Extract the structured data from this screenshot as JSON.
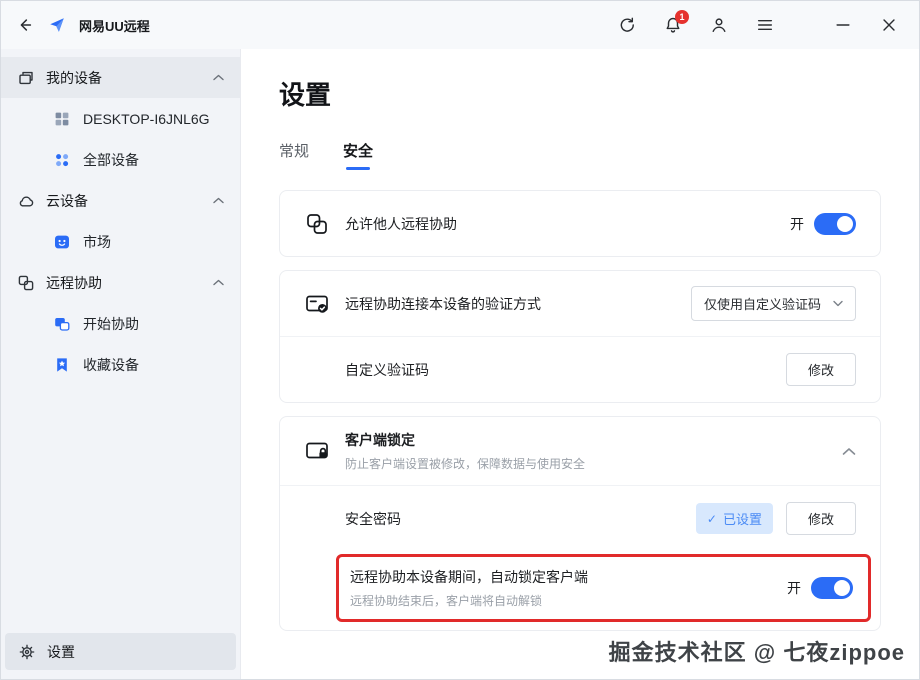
{
  "titlebar": {
    "app_title": "网易UU远程",
    "notification_badge": "1"
  },
  "sidebar": {
    "groups": [
      {
        "header": "我的设备",
        "items": [
          "DESKTOP-I6JNL6G",
          "全部设备"
        ]
      },
      {
        "header": "云设备",
        "items": [
          "市场"
        ]
      },
      {
        "header": "远程协助",
        "items": [
          "开始协助",
          "收藏设备"
        ]
      }
    ],
    "footer_label": "设置"
  },
  "main": {
    "page_title": "设置",
    "tabs": {
      "general": "常规",
      "security": "安全"
    },
    "rows": {
      "allow_assist": {
        "label": "允许他人远程协助",
        "state_label": "开"
      },
      "verify_method": {
        "label": "远程协助连接本设备的验证方式",
        "dropdown_value": "仅使用自定义验证码"
      },
      "custom_code": {
        "label": "自定义验证码",
        "button": "修改"
      },
      "client_lock": {
        "title": "客户端锁定",
        "subtitle": "防止客户端设置被修改，保障数据与使用安全"
      },
      "security_password": {
        "label": "安全密码",
        "badge": "已设置",
        "button": "修改"
      },
      "auto_lock": {
        "label": "远程协助本设备期间，自动锁定客户端",
        "subtitle": "远程协助结束后，客户端将自动解锁",
        "state_label": "开"
      }
    }
  },
  "watermark": "掘金技术社区 @ 七夜zippoe",
  "colors": {
    "accent_blue": "#2b6cf6",
    "highlight_red": "#e12a2a",
    "badge_bg": "#d8e8fd",
    "badge_text": "#4b8bf5"
  }
}
